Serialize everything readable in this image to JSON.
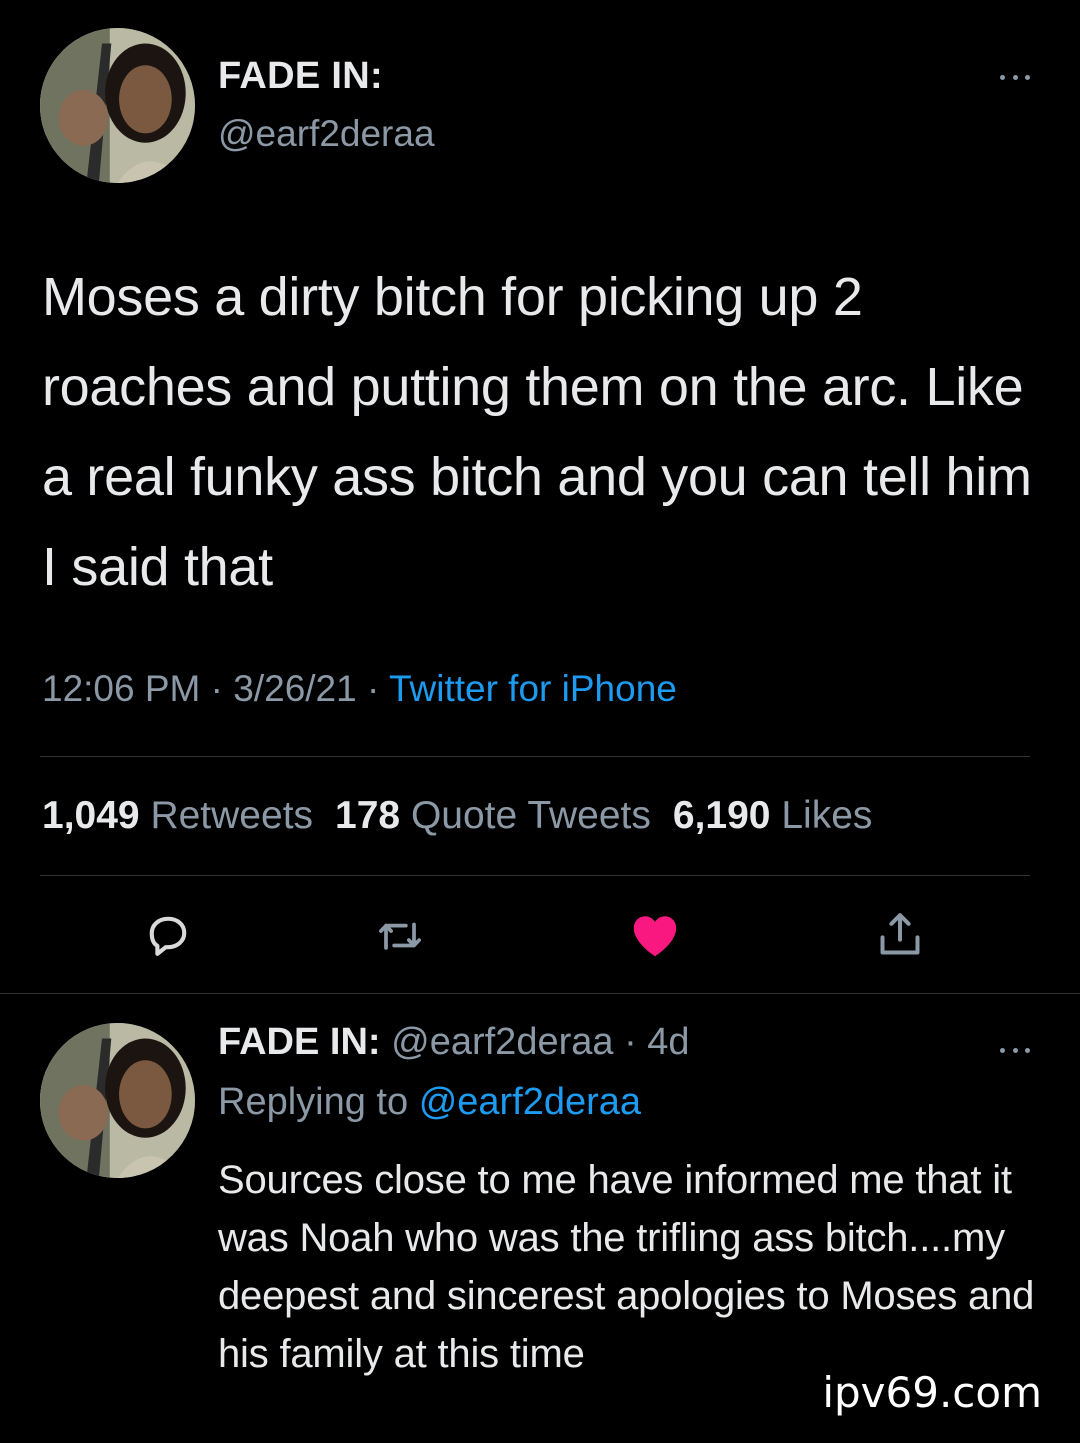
{
  "main_tweet": {
    "display_name": "FADE IN:",
    "handle": "@earf2deraa",
    "text": "Moses a dirty bitch for picking up 2 roaches and putting them on the arc. Like a real funky ass bitch and you can tell him I said that",
    "time": "12:06 PM",
    "date": "3/26/21",
    "separator": " · ",
    "source": "Twitter for iPhone",
    "stats": {
      "retweets_count": "1,049",
      "retweets_label": "Retweets",
      "quotes_count": "178",
      "quotes_label": "Quote Tweets",
      "likes_count": "6,190",
      "likes_label": "Likes"
    },
    "actions": {
      "reply_icon": "speech-bubble-icon",
      "retweet_icon": "retweet-icon",
      "like_icon": "heart-icon",
      "share_icon": "share-icon",
      "like_color": "#f91880"
    }
  },
  "reply_tweet": {
    "display_name": "FADE IN:",
    "handle": "@earf2deraa",
    "age": "4d",
    "separator": " · ",
    "replying_to_label": "Replying to",
    "replying_to_handle": "@earf2deraa",
    "text": "Sources close to me have informed me that it was Noah who was the trifling ass bitch....my deepest and sincerest apologies to Moses and his family at this time"
  },
  "watermark": "ipv69.com",
  "colors": {
    "background": "#000000",
    "text_primary": "#e7e9ea",
    "text_secondary": "#8b98a5",
    "link": "#1d9bf0",
    "divider": "#2f3336"
  }
}
